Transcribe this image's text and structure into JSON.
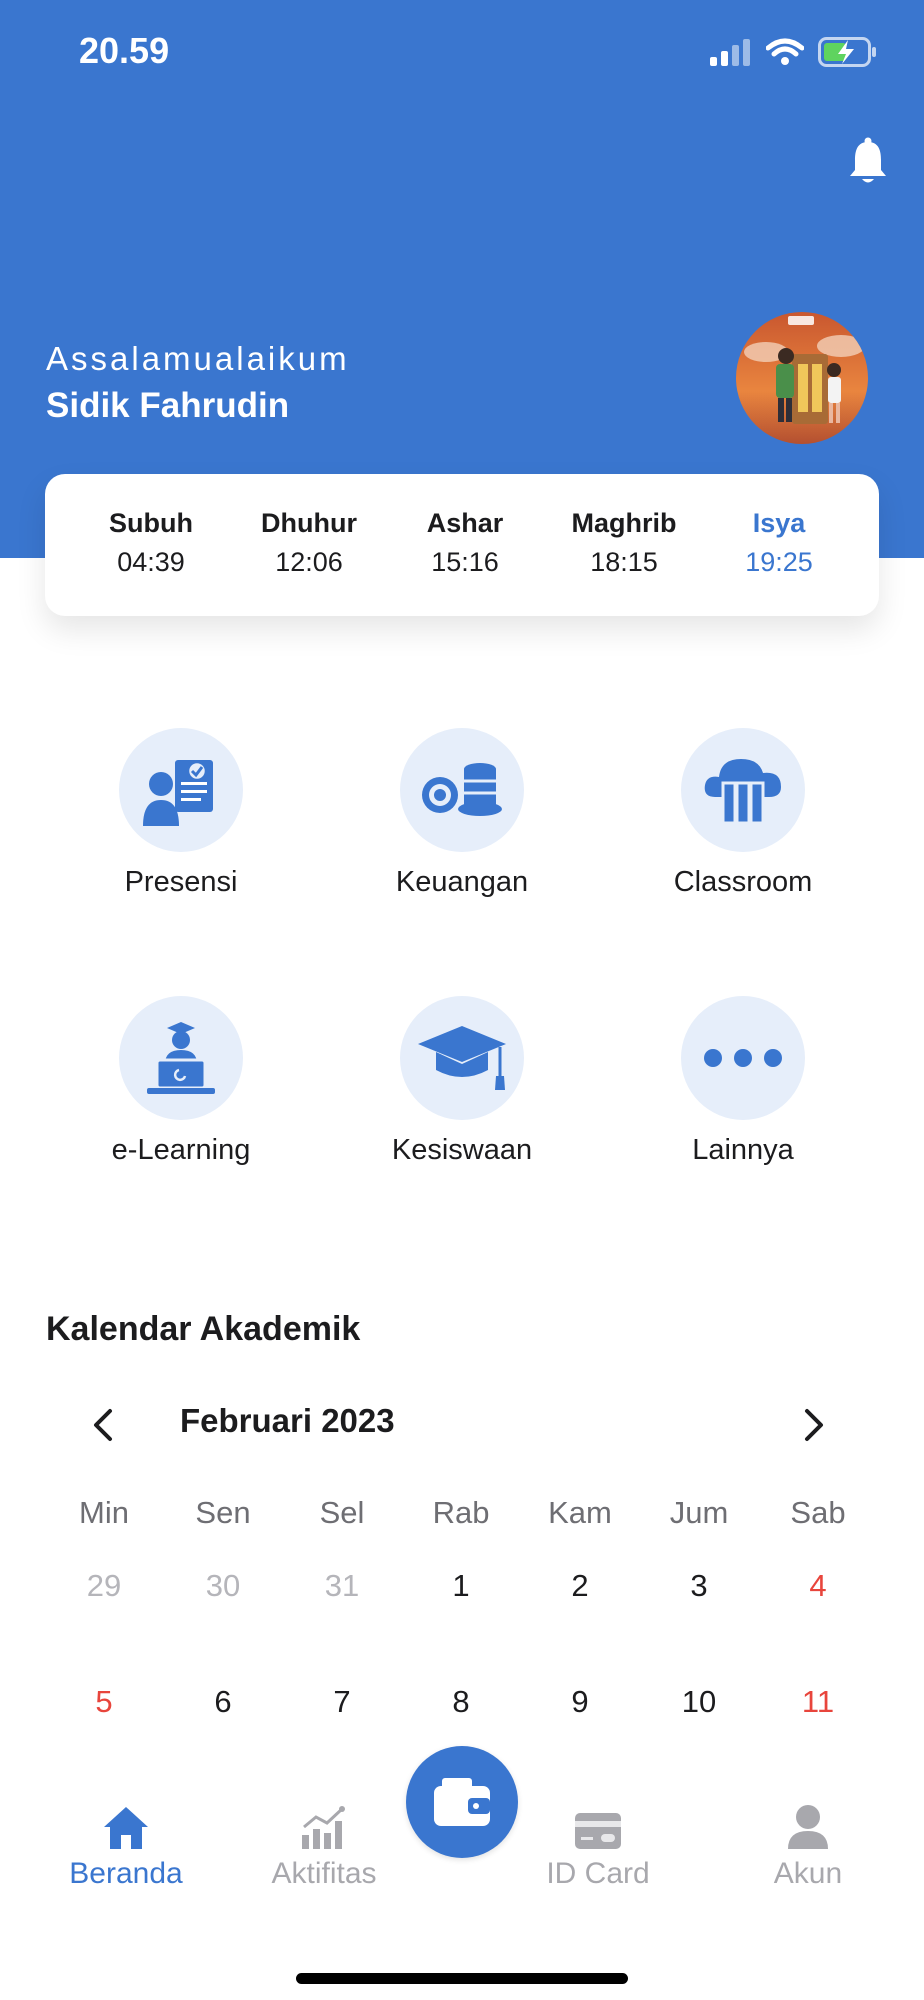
{
  "status_bar": {
    "time": "20.59"
  },
  "header": {
    "greeting": "Assalamualaikum",
    "user_name": "Sidik Fahrudin"
  },
  "prayer_times": [
    {
      "name": "Subuh",
      "time": "04:39",
      "active": false
    },
    {
      "name": "Dhuhur",
      "time": "12:06",
      "active": false
    },
    {
      "name": "Ashar",
      "time": "15:16",
      "active": false
    },
    {
      "name": "Maghrib",
      "time": "18:15",
      "active": false
    },
    {
      "name": "Isya",
      "time": "19:25",
      "active": true
    }
  ],
  "menu": [
    {
      "label": "Presensi",
      "icon": "attendance-icon"
    },
    {
      "label": "Keuangan",
      "icon": "coins-icon"
    },
    {
      "label": "Classroom",
      "icon": "cloud-library-icon"
    },
    {
      "label": "e-Learning",
      "icon": "laptop-student-icon"
    },
    {
      "label": "Kesiswaan",
      "icon": "graduation-cap-icon"
    },
    {
      "label": "Lainnya",
      "icon": "more-dots-icon"
    }
  ],
  "calendar": {
    "title": "Kalendar Akademik",
    "month": "Februari 2023",
    "weekdays": [
      "Min",
      "Sen",
      "Sel",
      "Rab",
      "Kam",
      "Jum",
      "Sab"
    ],
    "week1": [
      "29",
      "30",
      "31",
      "1",
      "2",
      "3",
      "4"
    ],
    "week2": [
      "5",
      "6",
      "7",
      "8",
      "9",
      "10",
      "11"
    ]
  },
  "bottom_nav": {
    "items": [
      {
        "label": "Beranda",
        "icon": "home-icon",
        "active": true
      },
      {
        "label": "Aktifitas",
        "icon": "bar-chart-icon",
        "active": false
      },
      {
        "label": "ID Card",
        "icon": "id-card-icon",
        "active": false
      },
      {
        "label": "Akun",
        "icon": "user-icon",
        "active": false
      }
    ],
    "center_icon": "wallet-icon"
  },
  "colors": {
    "primary": "#3a76cf",
    "icon_bg": "#e6eefa",
    "holiday": "#e8453c",
    "muted": "#b5b5ba",
    "nav_inactive": "#a8a8ad"
  }
}
